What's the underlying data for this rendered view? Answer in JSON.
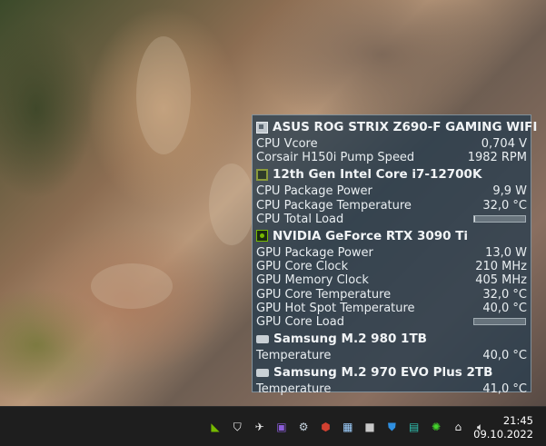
{
  "widget": {
    "devices": [
      {
        "name": "ASUS ROG STRIX Z690-F GAMING WIFI",
        "icon": "motherboard-icon",
        "sensors": [
          {
            "label": "CPU Vcore",
            "value": "0,704 V"
          },
          {
            "label": "Corsair H150i Pump Speed",
            "value": "1982 RPM"
          }
        ]
      },
      {
        "name": "12th Gen Intel Core i7-12700K",
        "icon": "cpu-icon",
        "sensors": [
          {
            "label": "CPU Package Power",
            "value": "9,9 W"
          },
          {
            "label": "CPU Package Temperature",
            "value": "32,0 °C"
          },
          {
            "label": "CPU Total Load",
            "bar_level": 0.02
          }
        ]
      },
      {
        "name": "NVIDIA GeForce RTX 3090 Ti",
        "icon": "nvidia-gpu-icon",
        "sensors": [
          {
            "label": "GPU Package Power",
            "value": "13,0 W"
          },
          {
            "label": "GPU Core Clock",
            "value": "210 MHz"
          },
          {
            "label": "GPU Memory Clock",
            "value": "405 MHz"
          },
          {
            "label": "GPU Core Temperature",
            "value": "32,0 °C"
          },
          {
            "label": "GPU Hot Spot Temperature",
            "value": "40,0 °C"
          },
          {
            "label": "GPU Core Load",
            "bar_level": 0.0
          }
        ]
      },
      {
        "name": "Samsung M.2 980 1TB",
        "icon": "ssd-icon",
        "sensors": [
          {
            "label": "Temperature",
            "value": "40,0 °C"
          }
        ]
      },
      {
        "name": "Samsung M.2 970 EVO Plus 2TB",
        "icon": "ssd-icon",
        "sensors": [
          {
            "label": "Temperature",
            "value": "41,0 °C"
          }
        ]
      }
    ]
  },
  "taskbar": {
    "tray_icons": [
      {
        "name": "nvidia-tray-icon",
        "glyph": "◣",
        "color": "#76b900"
      },
      {
        "name": "shield-tray-icon",
        "glyph": "⛉",
        "color": "#ffffff"
      },
      {
        "name": "airplane-tray-icon",
        "glyph": "✈",
        "color": "#e6e6e6"
      },
      {
        "name": "monitor-app-tray-icon",
        "glyph": "▣",
        "color": "#8a5cd8"
      },
      {
        "name": "steam-tray-icon",
        "glyph": "⚙",
        "color": "#c7d5e0"
      },
      {
        "name": "controller-tray-icon",
        "glyph": "⬢",
        "color": "#d04030"
      },
      {
        "name": "hwinfo-tray-icon",
        "glyph": "▦",
        "color": "#9fd0ff"
      },
      {
        "name": "app-square-tray-icon",
        "glyph": "■",
        "color": "#c8c8c8"
      },
      {
        "name": "defender-tray-icon",
        "glyph": "⛊",
        "color": "#2f8fe0"
      },
      {
        "name": "terminal-tray-icon",
        "glyph": "▤",
        "color": "#30c0b0"
      },
      {
        "name": "razer-tray-icon",
        "glyph": "✺",
        "color": "#44d62c"
      },
      {
        "name": "network-tray-icon",
        "glyph": "⌂",
        "color": "#e6e6e6"
      },
      {
        "name": "volume-tray-icon",
        "glyph": "🔈︎",
        "color": "#e6e6e6"
      }
    ],
    "clock": {
      "time": "21:45",
      "date": "09.10.2022"
    }
  }
}
